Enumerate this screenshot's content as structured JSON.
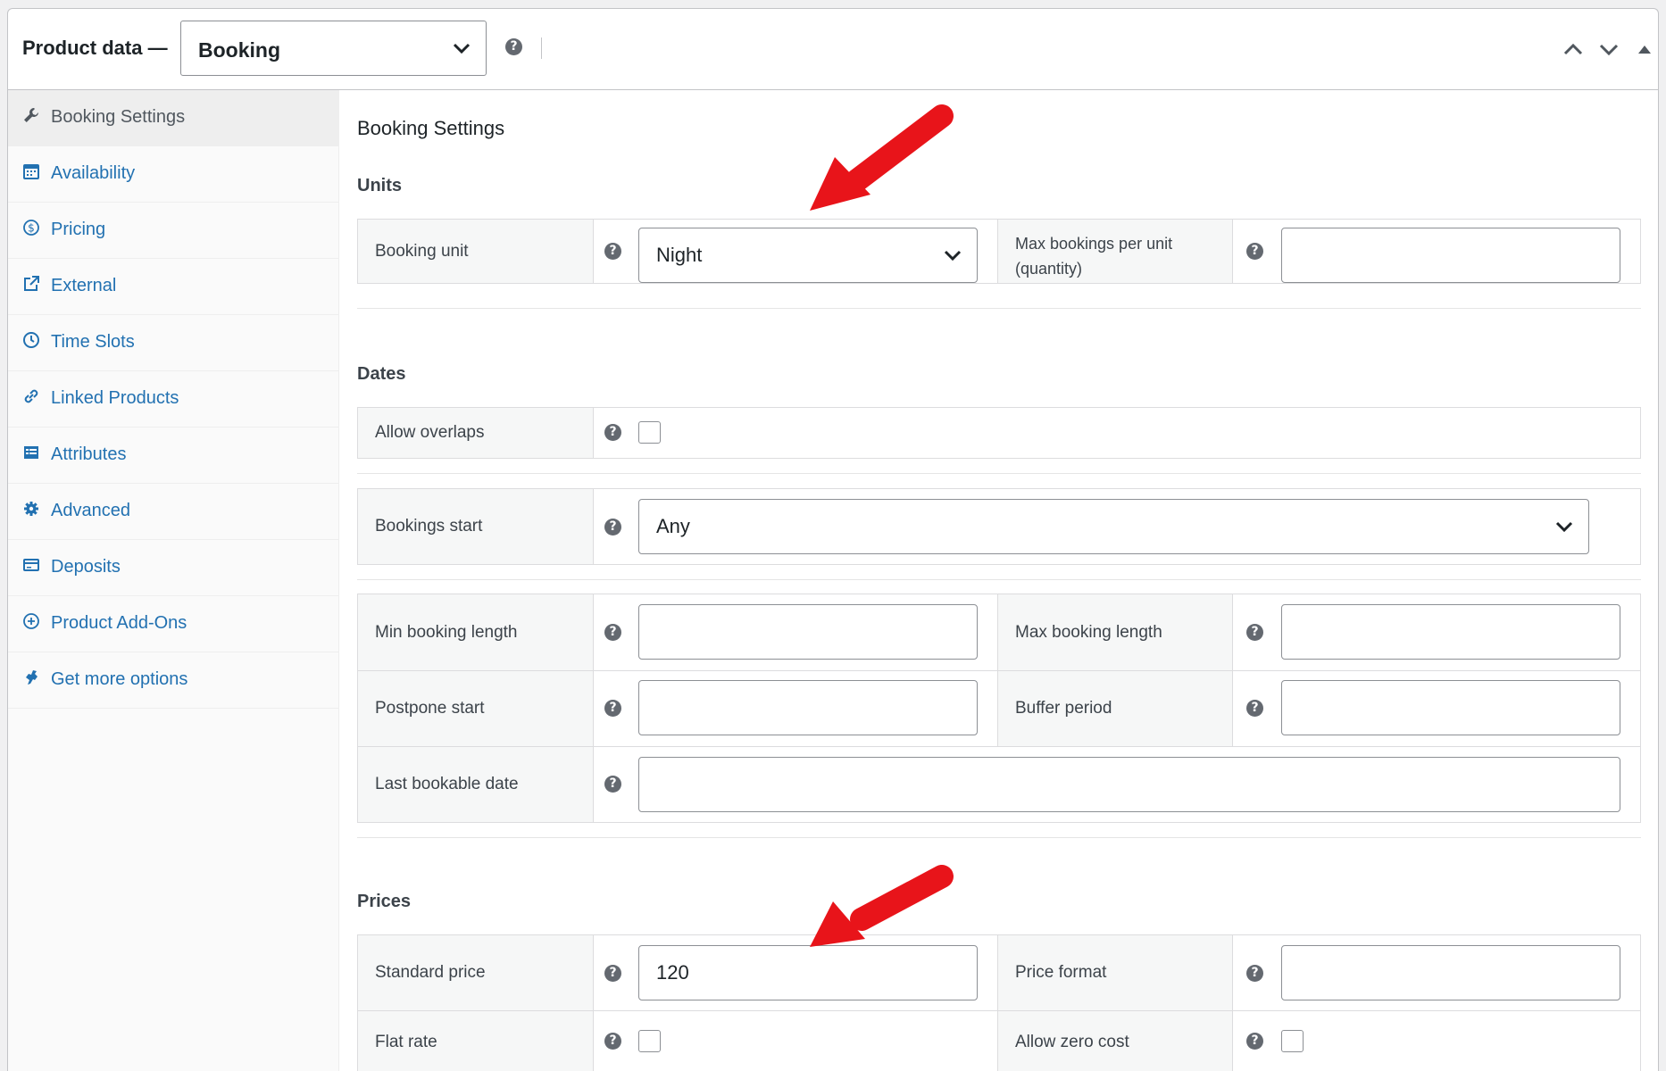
{
  "header": {
    "title": "Product data —",
    "product_type": "Booking"
  },
  "sidebar": {
    "items": [
      {
        "label": "Booking Settings",
        "icon": "wrench-icon"
      },
      {
        "label": "Availability",
        "icon": "calendar-icon"
      },
      {
        "label": "Pricing",
        "icon": "dollar-circle-icon"
      },
      {
        "label": "External",
        "icon": "external-link-icon"
      },
      {
        "label": "Time Slots",
        "icon": "clock-icon"
      },
      {
        "label": "Linked Products",
        "icon": "link-icon"
      },
      {
        "label": "Attributes",
        "icon": "list-table-icon"
      },
      {
        "label": "Advanced",
        "icon": "gear-icon"
      },
      {
        "label": "Deposits",
        "icon": "card-icon"
      },
      {
        "label": "Product Add-Ons",
        "icon": "plus-circle-icon"
      },
      {
        "label": "Get more options",
        "icon": "plugin-icon"
      }
    ]
  },
  "main": {
    "section_title": "Booking Settings",
    "units": {
      "heading": "Units",
      "booking_unit_label": "Booking unit",
      "booking_unit_value": "Night",
      "max_bookings_label_1": "Max bookings per unit",
      "max_bookings_label_2": "(quantity)",
      "max_bookings_value": ""
    },
    "dates": {
      "heading": "Dates",
      "allow_overlaps_label": "Allow overlaps",
      "bookings_start_label": "Bookings start",
      "bookings_start_value": "Any",
      "min_length_label": "Min booking length",
      "max_length_label": "Max booking length",
      "postpone_label": "Postpone start",
      "buffer_label": "Buffer period",
      "last_date_label": "Last bookable date"
    },
    "prices": {
      "heading": "Prices",
      "standard_label": "Standard price",
      "standard_value": "120",
      "format_label": "Price format",
      "flat_label": "Flat rate",
      "zero_label": "Allow zero cost"
    }
  },
  "colors": {
    "link": "#2271b1",
    "annotation_arrow": "#e8141a"
  }
}
